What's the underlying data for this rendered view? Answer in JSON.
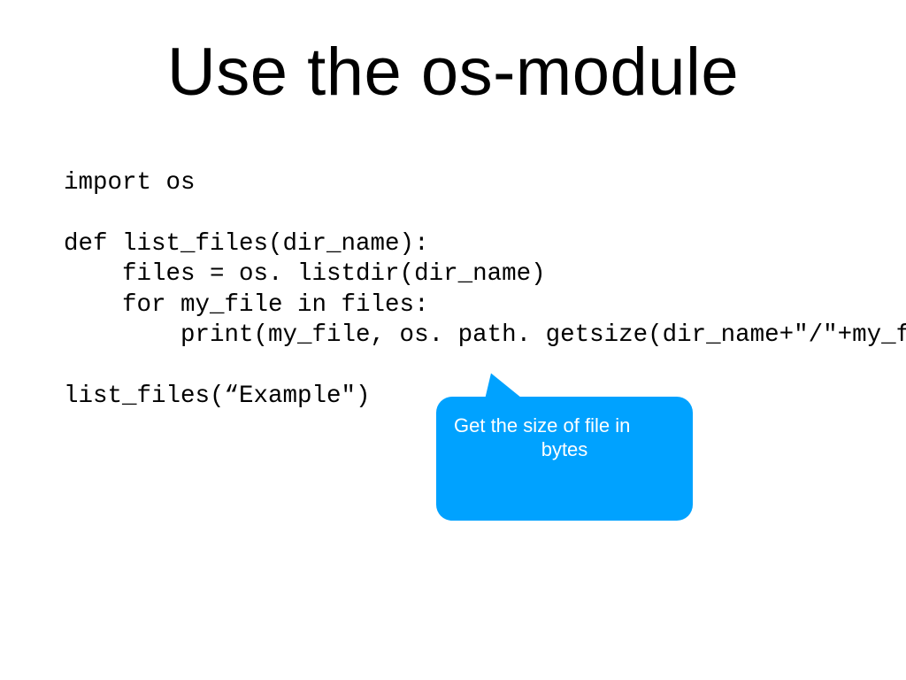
{
  "slide": {
    "title": "Use the os-module",
    "code_lines": {
      "l1": "import os",
      "l2": "",
      "l3": "def list_files(dir_name):",
      "l4": "    files = os. listdir(dir_name)",
      "l5": "    for my_file in files:",
      "l6": "        print(my_file, os. path. getsize(dir_name+\"/\"+my_fi",
      "l7": "",
      "l8": "list_files(“Example\")"
    },
    "callout": {
      "line1": "Get the size of file in",
      "line2": "bytes"
    },
    "colors": {
      "callout_bg": "#00a2ff",
      "callout_text": "#ffffff",
      "text": "#000000",
      "background": "#ffffff"
    }
  }
}
